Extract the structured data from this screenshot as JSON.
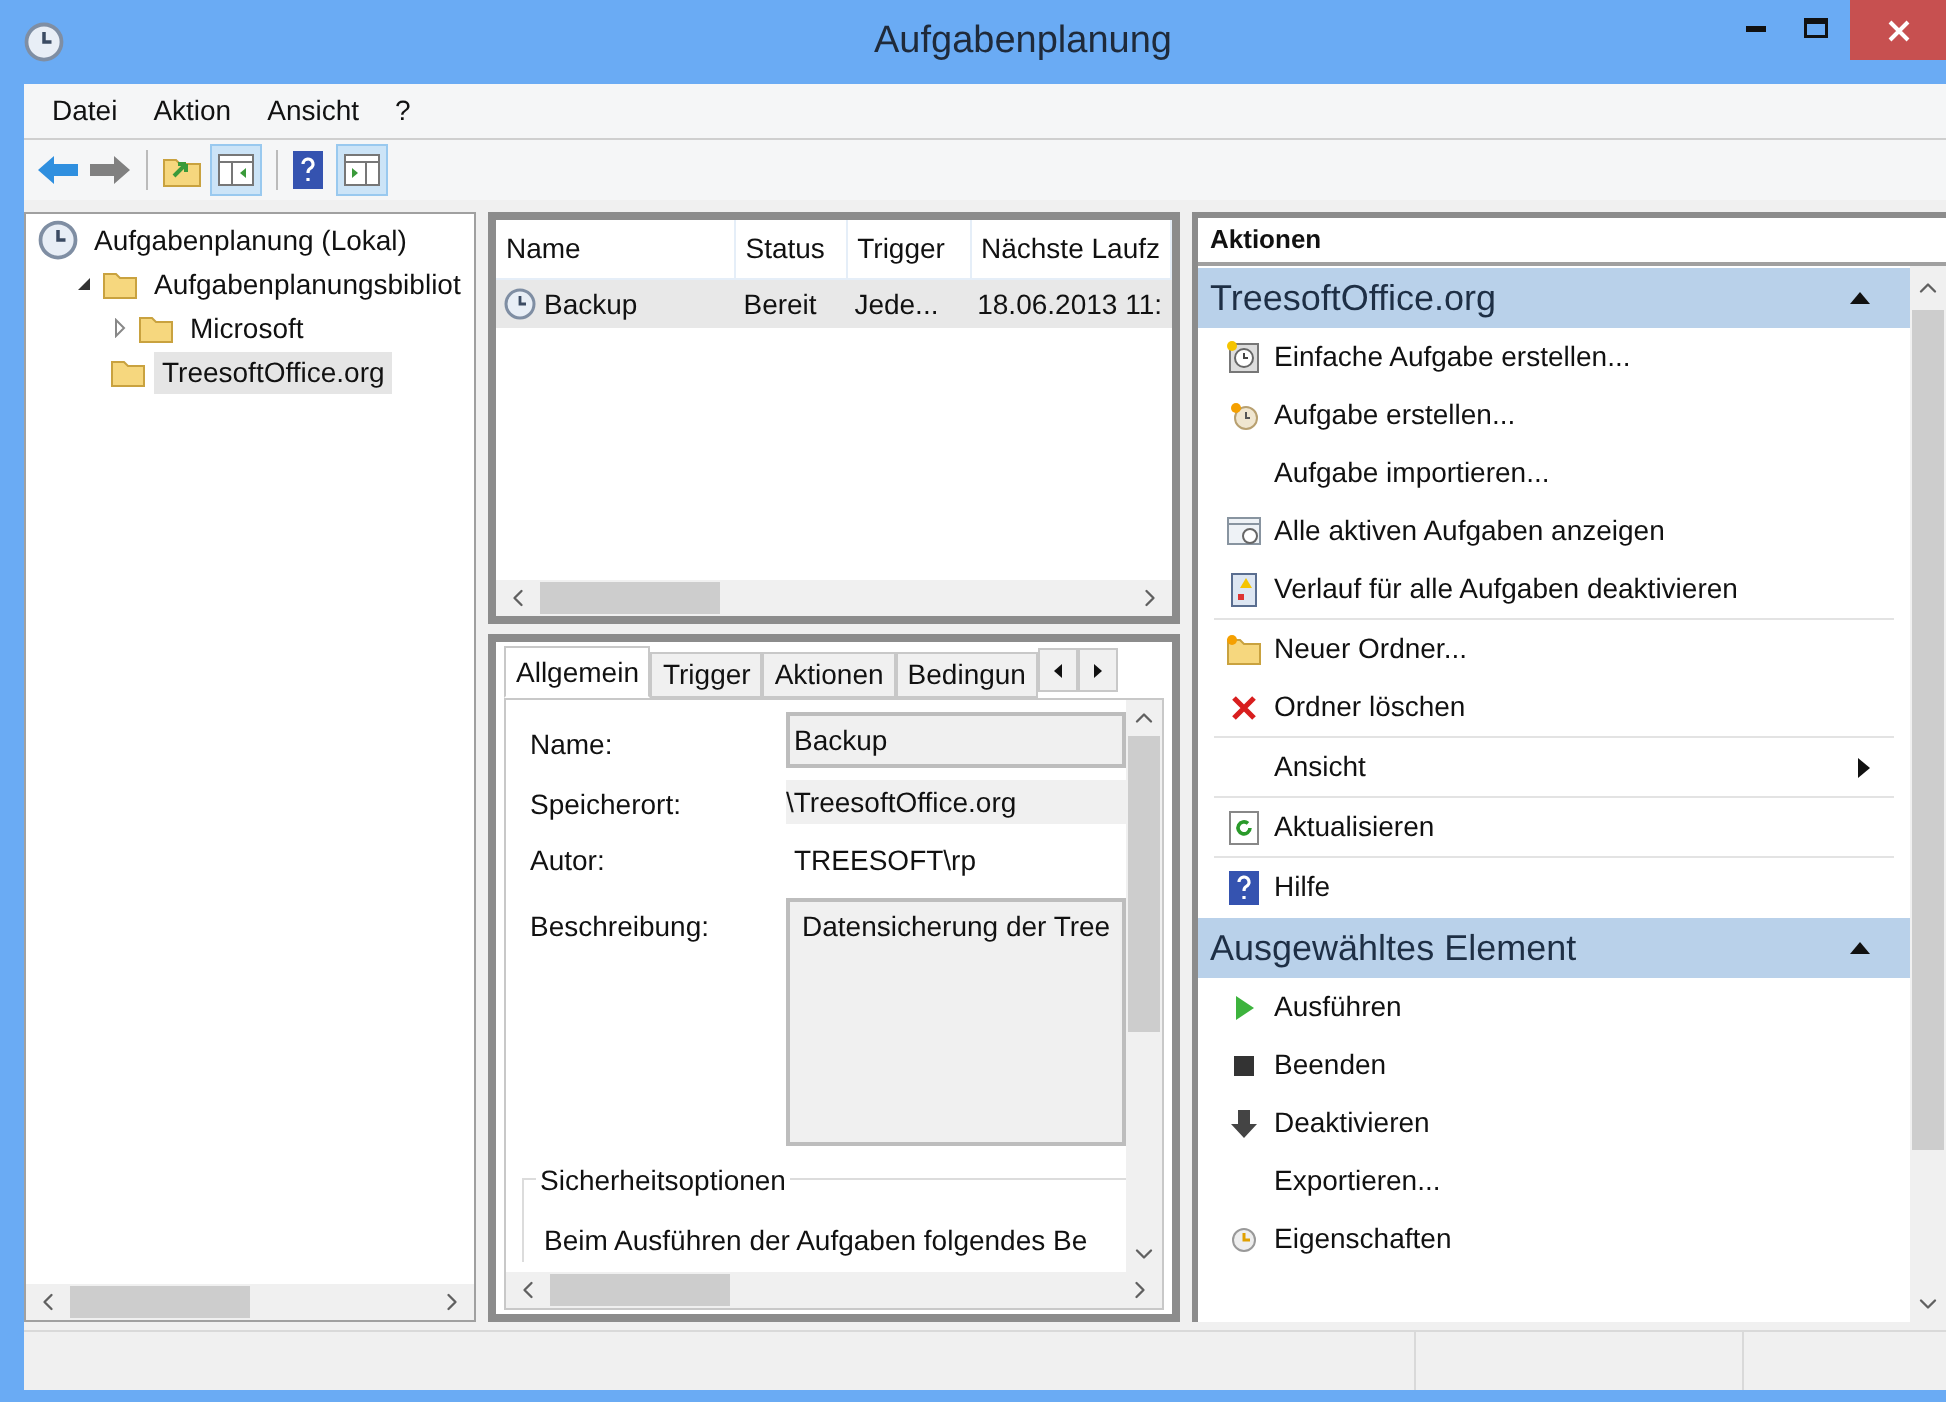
{
  "window": {
    "title": "Aufgabenplanung"
  },
  "menu": [
    "Datei",
    "Aktion",
    "Ansicht",
    "?"
  ],
  "tree": [
    {
      "label": "Aufgabenplanung (Lokal)",
      "selected": false,
      "children": [
        {
          "label": "Aufgabenplanungsbibliot",
          "selected": false,
          "expanded": true,
          "children": [
            {
              "label": "Microsoft",
              "selected": false,
              "expanded": false
            },
            {
              "label": "TreesoftOffice.org",
              "selected": true
            }
          ]
        }
      ]
    }
  ],
  "table": {
    "columns": [
      "Name",
      "Status",
      "Trigger",
      "Nächste Laufz"
    ],
    "rows": [
      {
        "cells": [
          "Backup",
          "Bereit",
          "Jede...",
          "18.06.2013 11:"
        ],
        "selected": true
      }
    ]
  },
  "tabs": [
    {
      "label": "Allgemein",
      "selected": true
    },
    {
      "label": "Trigger",
      "selected": false
    },
    {
      "label": "Aktionen",
      "selected": false
    },
    {
      "label": "Bedingun",
      "selected": false
    }
  ],
  "general": {
    "fields": [
      {
        "label": "Name:",
        "value": "Backup",
        "kind": "input"
      },
      {
        "label": "Speicherort:",
        "value": "\\TreesoftOffice.org",
        "kind": "readonly"
      },
      {
        "label": "Autor:",
        "value": "TREESOFT\\rp",
        "kind": "text"
      },
      {
        "label": "Beschreibung:",
        "value": "Datensicherung der Tree",
        "kind": "textarea"
      }
    ],
    "security": {
      "title": "Sicherheitsoptionen",
      "text": "Beim Ausführen der Aufgaben folgendes Be"
    }
  },
  "actions": {
    "title": "Aktionen",
    "sections": [
      {
        "title": "TreesoftOffice.org",
        "expanded": true,
        "groups": [
          [
            {
              "label": "Einfache Aufgabe erstellen...",
              "submenu": false
            },
            {
              "label": "Aufgabe erstellen...",
              "submenu": false
            },
            {
              "label": "Aufgabe importieren...",
              "submenu": false
            },
            {
              "label": "Alle aktiven Aufgaben anzeigen",
              "submenu": false
            },
            {
              "label": "Verlauf für alle Aufgaben deaktivieren",
              "submenu": false
            }
          ],
          [
            {
              "label": "Neuer Ordner...",
              "submenu": false
            },
            {
              "label": "Ordner löschen",
              "submenu": false
            }
          ],
          [
            {
              "label": "Ansicht",
              "submenu": true
            }
          ],
          [
            {
              "label": "Aktualisieren",
              "submenu": false
            }
          ],
          [
            {
              "label": "Hilfe",
              "submenu": false
            }
          ]
        ]
      },
      {
        "title": "Ausgewähltes Element",
        "expanded": true,
        "groups": [
          [
            {
              "label": "Ausführen",
              "submenu": false
            },
            {
              "label": "Beenden",
              "submenu": false
            },
            {
              "label": "Deaktivieren",
              "submenu": false
            },
            {
              "label": "Exportieren...",
              "submenu": false
            },
            {
              "label": "Eigenschaften",
              "submenu": false
            }
          ]
        ]
      }
    ]
  }
}
